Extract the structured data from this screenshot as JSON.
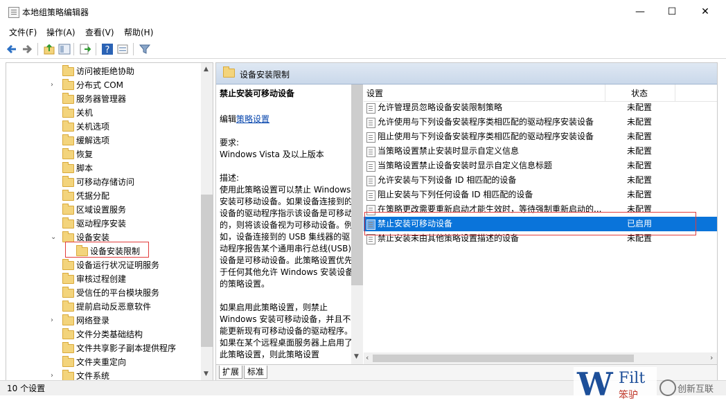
{
  "window": {
    "title": "本地组策略编辑器",
    "minimize": "—",
    "maximize": "☐",
    "close": "✕"
  },
  "menu": [
    "文件(F)",
    "操作(A)",
    "查看(V)",
    "帮助(H)"
  ],
  "tree": [
    {
      "label": "访问被拒绝协助",
      "level": 1,
      "arrow": ""
    },
    {
      "label": "分布式 COM",
      "level": 1,
      "arrow": "›"
    },
    {
      "label": "服务器管理器",
      "level": 1,
      "arrow": ""
    },
    {
      "label": "关机",
      "level": 1,
      "arrow": ""
    },
    {
      "label": "关机选项",
      "level": 1,
      "arrow": ""
    },
    {
      "label": "缓解选项",
      "level": 1,
      "arrow": ""
    },
    {
      "label": "恢复",
      "level": 1,
      "arrow": ""
    },
    {
      "label": "脚本",
      "level": 1,
      "arrow": ""
    },
    {
      "label": "可移动存储访问",
      "level": 1,
      "arrow": ""
    },
    {
      "label": "凭据分配",
      "level": 1,
      "arrow": ""
    },
    {
      "label": "区域设置服务",
      "level": 1,
      "arrow": ""
    },
    {
      "label": "驱动程序安装",
      "level": 1,
      "arrow": ""
    },
    {
      "label": "设备安装",
      "level": 1,
      "arrow": "⌄"
    },
    {
      "label": "设备安装限制",
      "level": 2,
      "arrow": ""
    },
    {
      "label": "设备运行状况证明服务",
      "level": 1,
      "arrow": ""
    },
    {
      "label": "审核过程创建",
      "level": 1,
      "arrow": ""
    },
    {
      "label": "受信任的平台模块服务",
      "level": 1,
      "arrow": ""
    },
    {
      "label": "提前启动反恶意软件",
      "level": 1,
      "arrow": ""
    },
    {
      "label": "网络登录",
      "level": 1,
      "arrow": "›"
    },
    {
      "label": "文件分类基础结构",
      "level": 1,
      "arrow": ""
    },
    {
      "label": "文件共享影子副本提供程序",
      "level": 1,
      "arrow": ""
    },
    {
      "label": "文件夹重定向",
      "level": 1,
      "arrow": ""
    },
    {
      "label": "文件系统",
      "level": 1,
      "arrow": "›"
    }
  ],
  "right": {
    "header": "设备安装限制",
    "desc_title": "禁止安装可移动设备",
    "edit_prefix": "编辑",
    "edit_link": "策略设置",
    "req_label": "要求:",
    "req_value": "Windows Vista 及以上版本",
    "desc_label": "描述:",
    "desc_p1": "使用此策略设置可以禁止 Windows 安装可移动设备。如果设备连接到的设备的驱动程序指示该设备是可移动的，则将该设备视为可移动设备。例如，设备连接到的 USB 集线器的驱动程序报告某个通用串行总线(USB)设备是可移动设备。此策略设置优先于任何其他允许 Windows 安装设备的策略设置。",
    "desc_p2": "如果启用此策略设置，则禁止 Windows 安装可移动设备，并且不能更新现有可移动设备的驱动程序。如果在某个远程桌面服务器上启用了此策略设置，则此策略设置"
  },
  "list": {
    "col_setting": "设置",
    "col_state": "状态",
    "rows": [
      {
        "name": "允许管理员忽略设备安装限制策略",
        "state": "未配置"
      },
      {
        "name": "允许使用与下列设备安装程序类相匹配的驱动程序安装设备",
        "state": "未配置"
      },
      {
        "name": "阻止使用与下列设备安装程序类相匹配的驱动程序安装设备",
        "state": "未配置"
      },
      {
        "name": "当策略设置禁止安装时显示自定义信息",
        "state": "未配置"
      },
      {
        "name": "当策略设置禁止设备安装时显示自定义信息标题",
        "state": "未配置"
      },
      {
        "name": "允许安装与下列设备 ID 相匹配的设备",
        "state": "未配置"
      },
      {
        "name": "阻止安装与下列任何设备 ID 相匹配的设备",
        "state": "未配置"
      },
      {
        "name": "在策略更改需要重新启动才能生效时，等待强制重新启动的...",
        "state": "未配置"
      },
      {
        "name": "禁止安装可移动设备",
        "state": "已启用",
        "selected": true
      },
      {
        "name": "禁止安装未由其他策略设置描述的设备",
        "state": "未配置"
      }
    ]
  },
  "tabs": [
    "扩展",
    "标准"
  ],
  "status": "10 个设置",
  "watermark": {
    "brand_big": "W",
    "brand_text": "Filt",
    "brand_cn": "笨驴",
    "site": "创新互联"
  }
}
